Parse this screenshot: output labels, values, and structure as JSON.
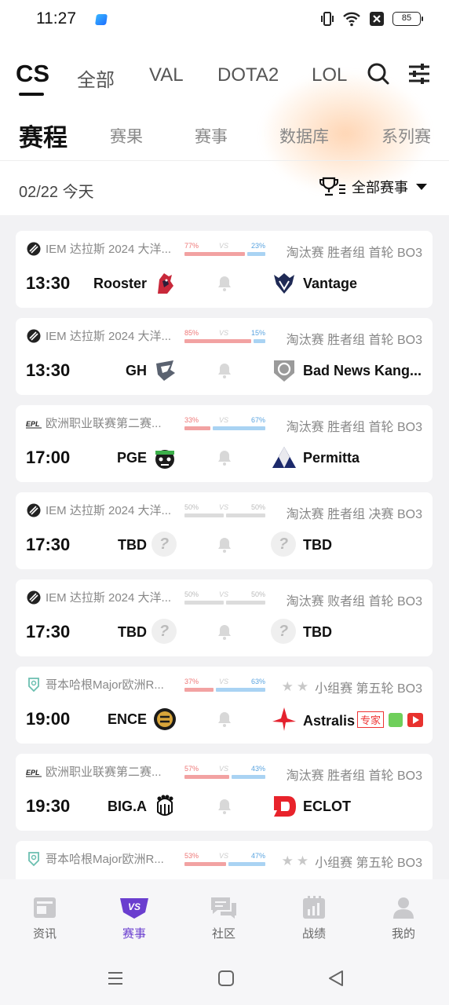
{
  "status_bar": {
    "time": "11:27",
    "battery": "85"
  },
  "game_tabs": [
    "CS",
    "全部",
    "VAL",
    "DOTA2",
    "LOL"
  ],
  "sub_tabs": [
    "赛程",
    "赛果",
    "赛事",
    "数据库",
    "系列赛"
  ],
  "date": "02/22 今天",
  "filter_label": "全部赛事",
  "matches": [
    {
      "league": "IEM 达拉斯 2024 大洋...",
      "odds_left": "77%",
      "odds_right": "23%",
      "odds_left_frac": 0.77,
      "stage": "淘汰赛 胜者组 首轮 BO3",
      "time": "13:30",
      "team1": "Rooster",
      "team2": "Vantage"
    },
    {
      "league": "IEM 达拉斯 2024 大洋...",
      "odds_left": "85%",
      "odds_right": "15%",
      "odds_left_frac": 0.85,
      "stage": "淘汰赛 胜者组 首轮 BO3",
      "time": "13:30",
      "team1": "GH",
      "team2": "Bad News Kang..."
    },
    {
      "league": "欧洲职业联赛第二赛...",
      "odds_left": "33%",
      "odds_right": "67%",
      "odds_left_frac": 0.33,
      "stage": "淘汰赛 胜者组 首轮 BO3",
      "time": "17:00",
      "team1": "PGE",
      "team2": "Permitta"
    },
    {
      "league": "IEM 达拉斯 2024 大洋...",
      "odds_left": "50%",
      "odds_right": "50%",
      "odds_left_frac": 0.5,
      "stage": "淘汰赛 胜者组 决赛 BO3",
      "time": "17:30",
      "team1": "TBD",
      "team2": "TBD"
    },
    {
      "league": "IEM 达拉斯 2024 大洋...",
      "odds_left": "50%",
      "odds_right": "50%",
      "odds_left_frac": 0.5,
      "stage": "淘汰赛 败者组 首轮 BO3",
      "time": "17:30",
      "team1": "TBD",
      "team2": "TBD"
    },
    {
      "league": "哥本哈根Major欧洲R...",
      "odds_left": "37%",
      "odds_right": "63%",
      "odds_left_frac": 0.37,
      "stage": "小组赛 第五轮 BO3",
      "time": "19:00",
      "team1": "ENCE",
      "team2": "Astralis",
      "badge": "专家"
    },
    {
      "league": "欧洲职业联赛第二赛...",
      "odds_left": "57%",
      "odds_right": "43%",
      "odds_left_frac": 0.57,
      "stage": "淘汰赛 胜者组 首轮 BO3",
      "time": "19:30",
      "team1": "BIG.A",
      "team2": "ECLOT"
    },
    {
      "league": "哥本哈根Major欧洲R...",
      "odds_left": "53%",
      "odds_right": "47%",
      "odds_left_frac": 0.53,
      "stage": "小组赛 第五轮 BO3"
    }
  ],
  "odds_vs": "VS",
  "bottom_nav": [
    "资讯",
    "赛事",
    "社区",
    "战绩",
    "我的"
  ],
  "colors": {
    "accent": "#6a3ecf",
    "odds_red": "#f2a2a2",
    "odds_blue": "#a9d3f3"
  }
}
